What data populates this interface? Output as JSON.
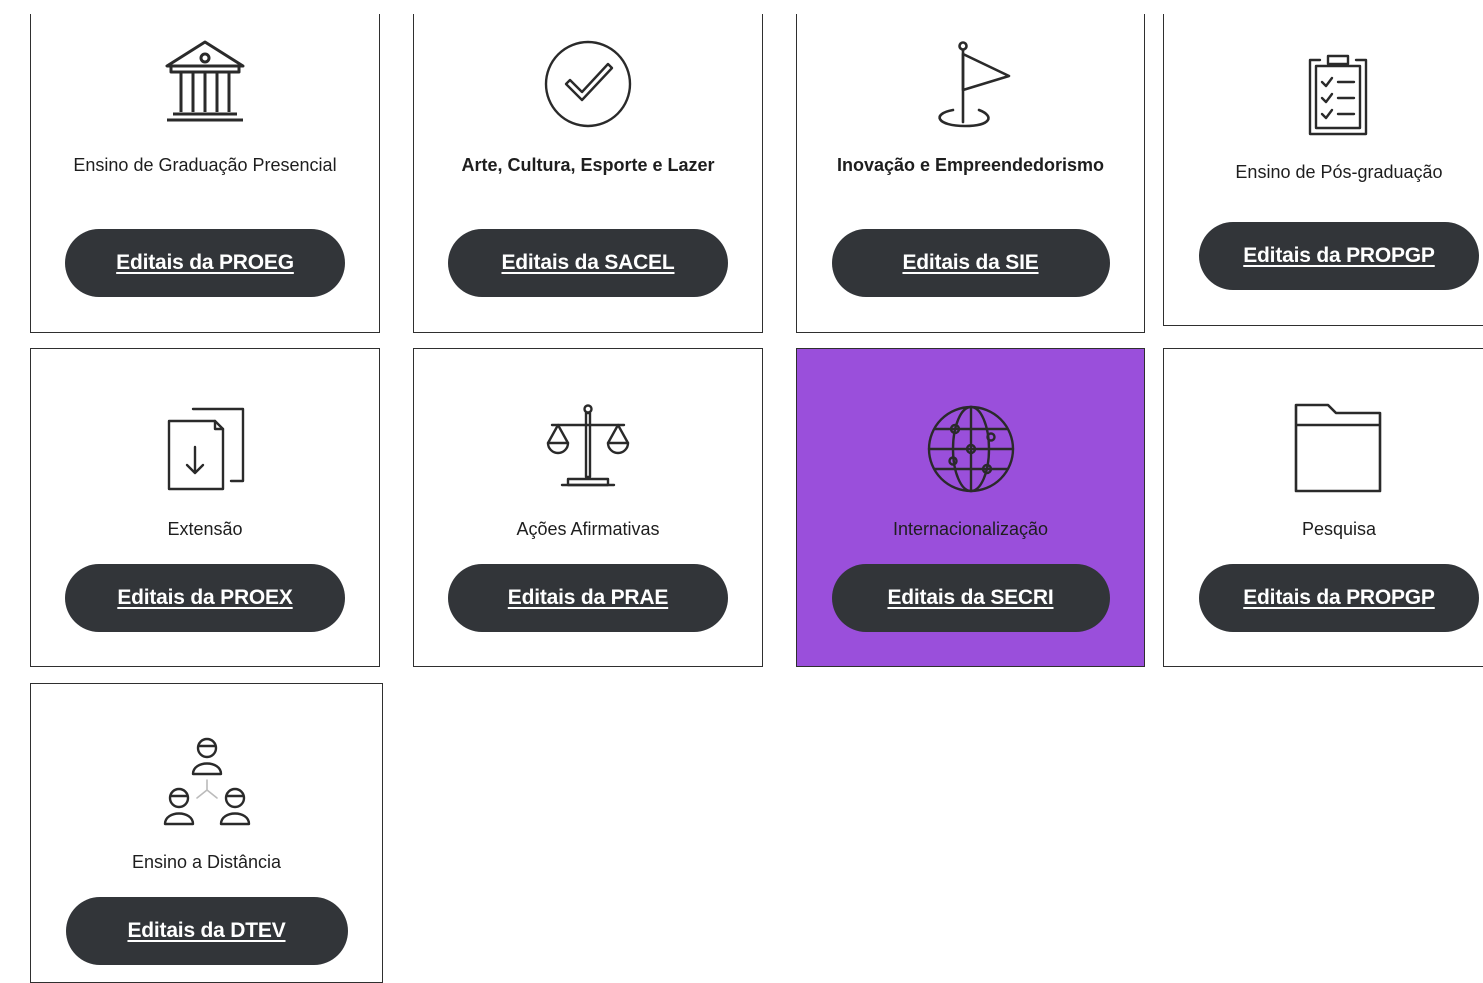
{
  "cards": [
    {
      "title": "Ensino de Graduação Presencial",
      "button": "Editais da PROEG",
      "icon": "institution-icon"
    },
    {
      "title": "Arte, Cultura, Esporte e Lazer",
      "button": "Editais da SACEL",
      "icon": "checkmark-circle-icon"
    },
    {
      "title": "Inovação e Empreendedorismo",
      "button": "Editais da SIE",
      "icon": "flag-icon"
    },
    {
      "title": "Ensino de Pós-graduação",
      "button": "Editais da PROPGP",
      "icon": "clipboard-checklist-icon"
    },
    {
      "title": "Extensão",
      "button": "Editais da PROEX",
      "icon": "document-download-icon"
    },
    {
      "title": "Ações Afirmativas",
      "button": "Editais da PRAE",
      "icon": "scales-icon"
    },
    {
      "title": "Internacionalização",
      "button": "Editais da SECRI",
      "icon": "globe-network-icon"
    },
    {
      "title": "Pesquisa",
      "button": "Editais da PROPGP",
      "icon": "folder-icon"
    },
    {
      "title": "Ensino a Distância",
      "button": "Editais da DTEV",
      "icon": "people-network-icon"
    }
  ],
  "colors": {
    "highlight": "#9a4fdb",
    "button": "#323539",
    "border": "#2f2f2f"
  }
}
